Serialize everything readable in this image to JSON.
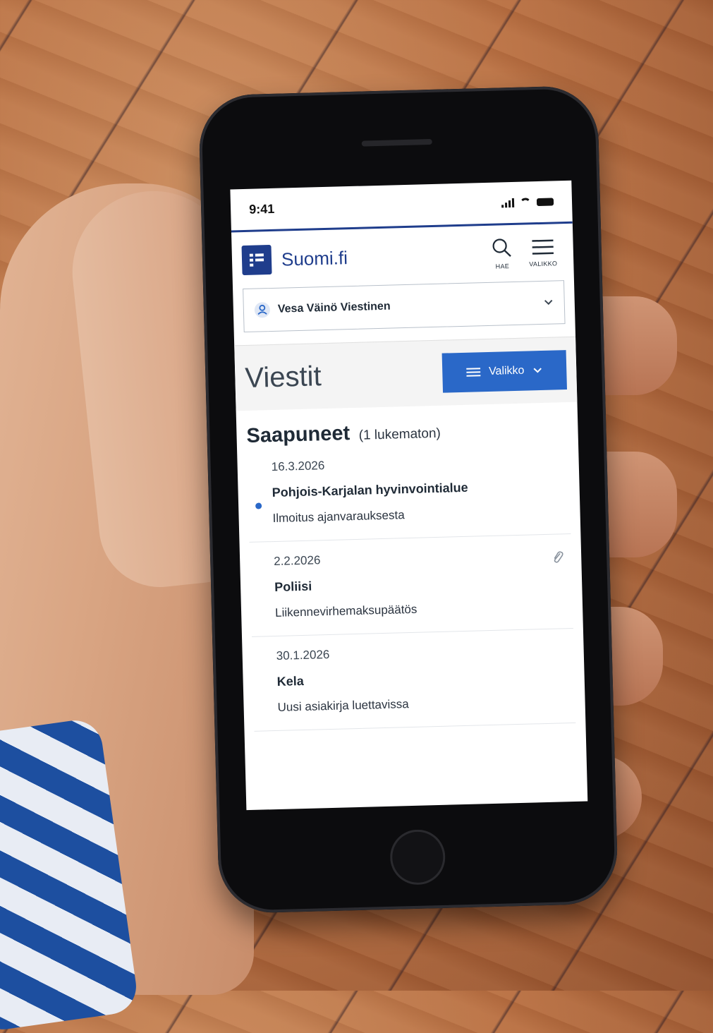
{
  "status_bar": {
    "time": "9:41"
  },
  "header": {
    "brand": "Suomi.fi",
    "search_label": "HAE",
    "menu_label": "VALIKKO"
  },
  "user_selector": {
    "name": "Vesa Väinö Viestinen"
  },
  "page": {
    "title": "Viestit",
    "menu_button_label": "Valikko"
  },
  "inbox": {
    "title": "Saapuneet",
    "unread_count": "(1 lukematon)",
    "messages": [
      {
        "date": "16.3.2026",
        "sender": "Pohjois-Karjalan hyvinvointialue",
        "subject": "Ilmoitus ajanvarauksesta",
        "unread": true,
        "attachment": false
      },
      {
        "date": "2.2.2026",
        "sender": "Poliisi",
        "subject": "Liikennevirhemaksupäätös",
        "unread": false,
        "attachment": true
      },
      {
        "date": "30.1.2026",
        "sender": "Kela",
        "subject": "Uusi asiakirja luettavissa",
        "unread": false,
        "attachment": false
      }
    ]
  },
  "colors": {
    "brand_blue": "#1f3d8c",
    "button_blue": "#2a68c8",
    "unread_dot": "#2a68c8"
  }
}
